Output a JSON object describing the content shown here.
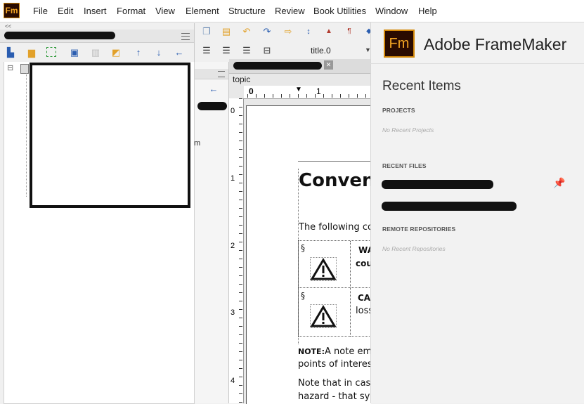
{
  "app": {
    "logo_text": "Fm",
    "name": "Adobe FrameMaker"
  },
  "menu": [
    "File",
    "Edit",
    "Insert",
    "Format",
    "View",
    "Element",
    "Structure",
    "Review",
    "Book Utilities",
    "Window",
    "Help"
  ],
  "left_panel": {
    "collapse_glyph": "<<",
    "tree_expander": "⊟"
  },
  "mid_panel": {
    "stub_text": "m"
  },
  "doc_toolbar": {
    "style_select_value": "title.0"
  },
  "document": {
    "tab_close": "✕",
    "breadcrumb": "topic",
    "ruler_labels": [
      "0",
      "1"
    ],
    "ruler_v_labels": [
      "0",
      "1",
      "2",
      "3",
      "4"
    ],
    "heading": "Convent",
    "intro": "The following co",
    "row_marker": "§",
    "row1_title": "WA",
    "row1_sub": "cou",
    "row2_title": "CA",
    "row2_sub": "loss",
    "note_label": "NOTE:",
    "note_text": "A note em",
    "note_line2": "points of interes",
    "para2_line1": "Note that in cas",
    "para2_line2": "hazard - that sy"
  },
  "recent": {
    "title": "Recent Items",
    "projects_label": "PROJECTS",
    "projects_empty": "No Recent Projects",
    "files_label": "RECENT FILES",
    "remote_label": "REMOTE REPOSITORIES",
    "remote_empty": "No Recent Repositories"
  },
  "colors": {
    "accent": "#f5a623",
    "logo_bg": "#2a0b00",
    "toolbar_blue": "#2a5db0"
  }
}
